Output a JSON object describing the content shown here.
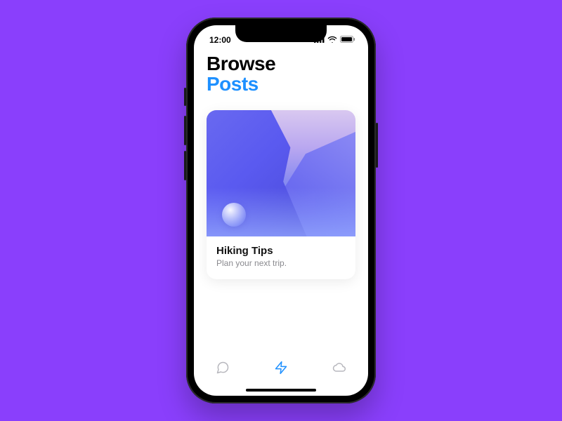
{
  "status": {
    "time": "12:00"
  },
  "header": {
    "line1": "Browse",
    "line2": "Posts"
  },
  "card": {
    "title": "Hiking Tips",
    "subtitle": "Plan your next trip."
  },
  "colors": {
    "accent": "#1e90ff",
    "background": "#8A3FFC"
  },
  "tabs": {
    "items": [
      "chat",
      "lightning",
      "cloud"
    ],
    "active_index": 1
  }
}
